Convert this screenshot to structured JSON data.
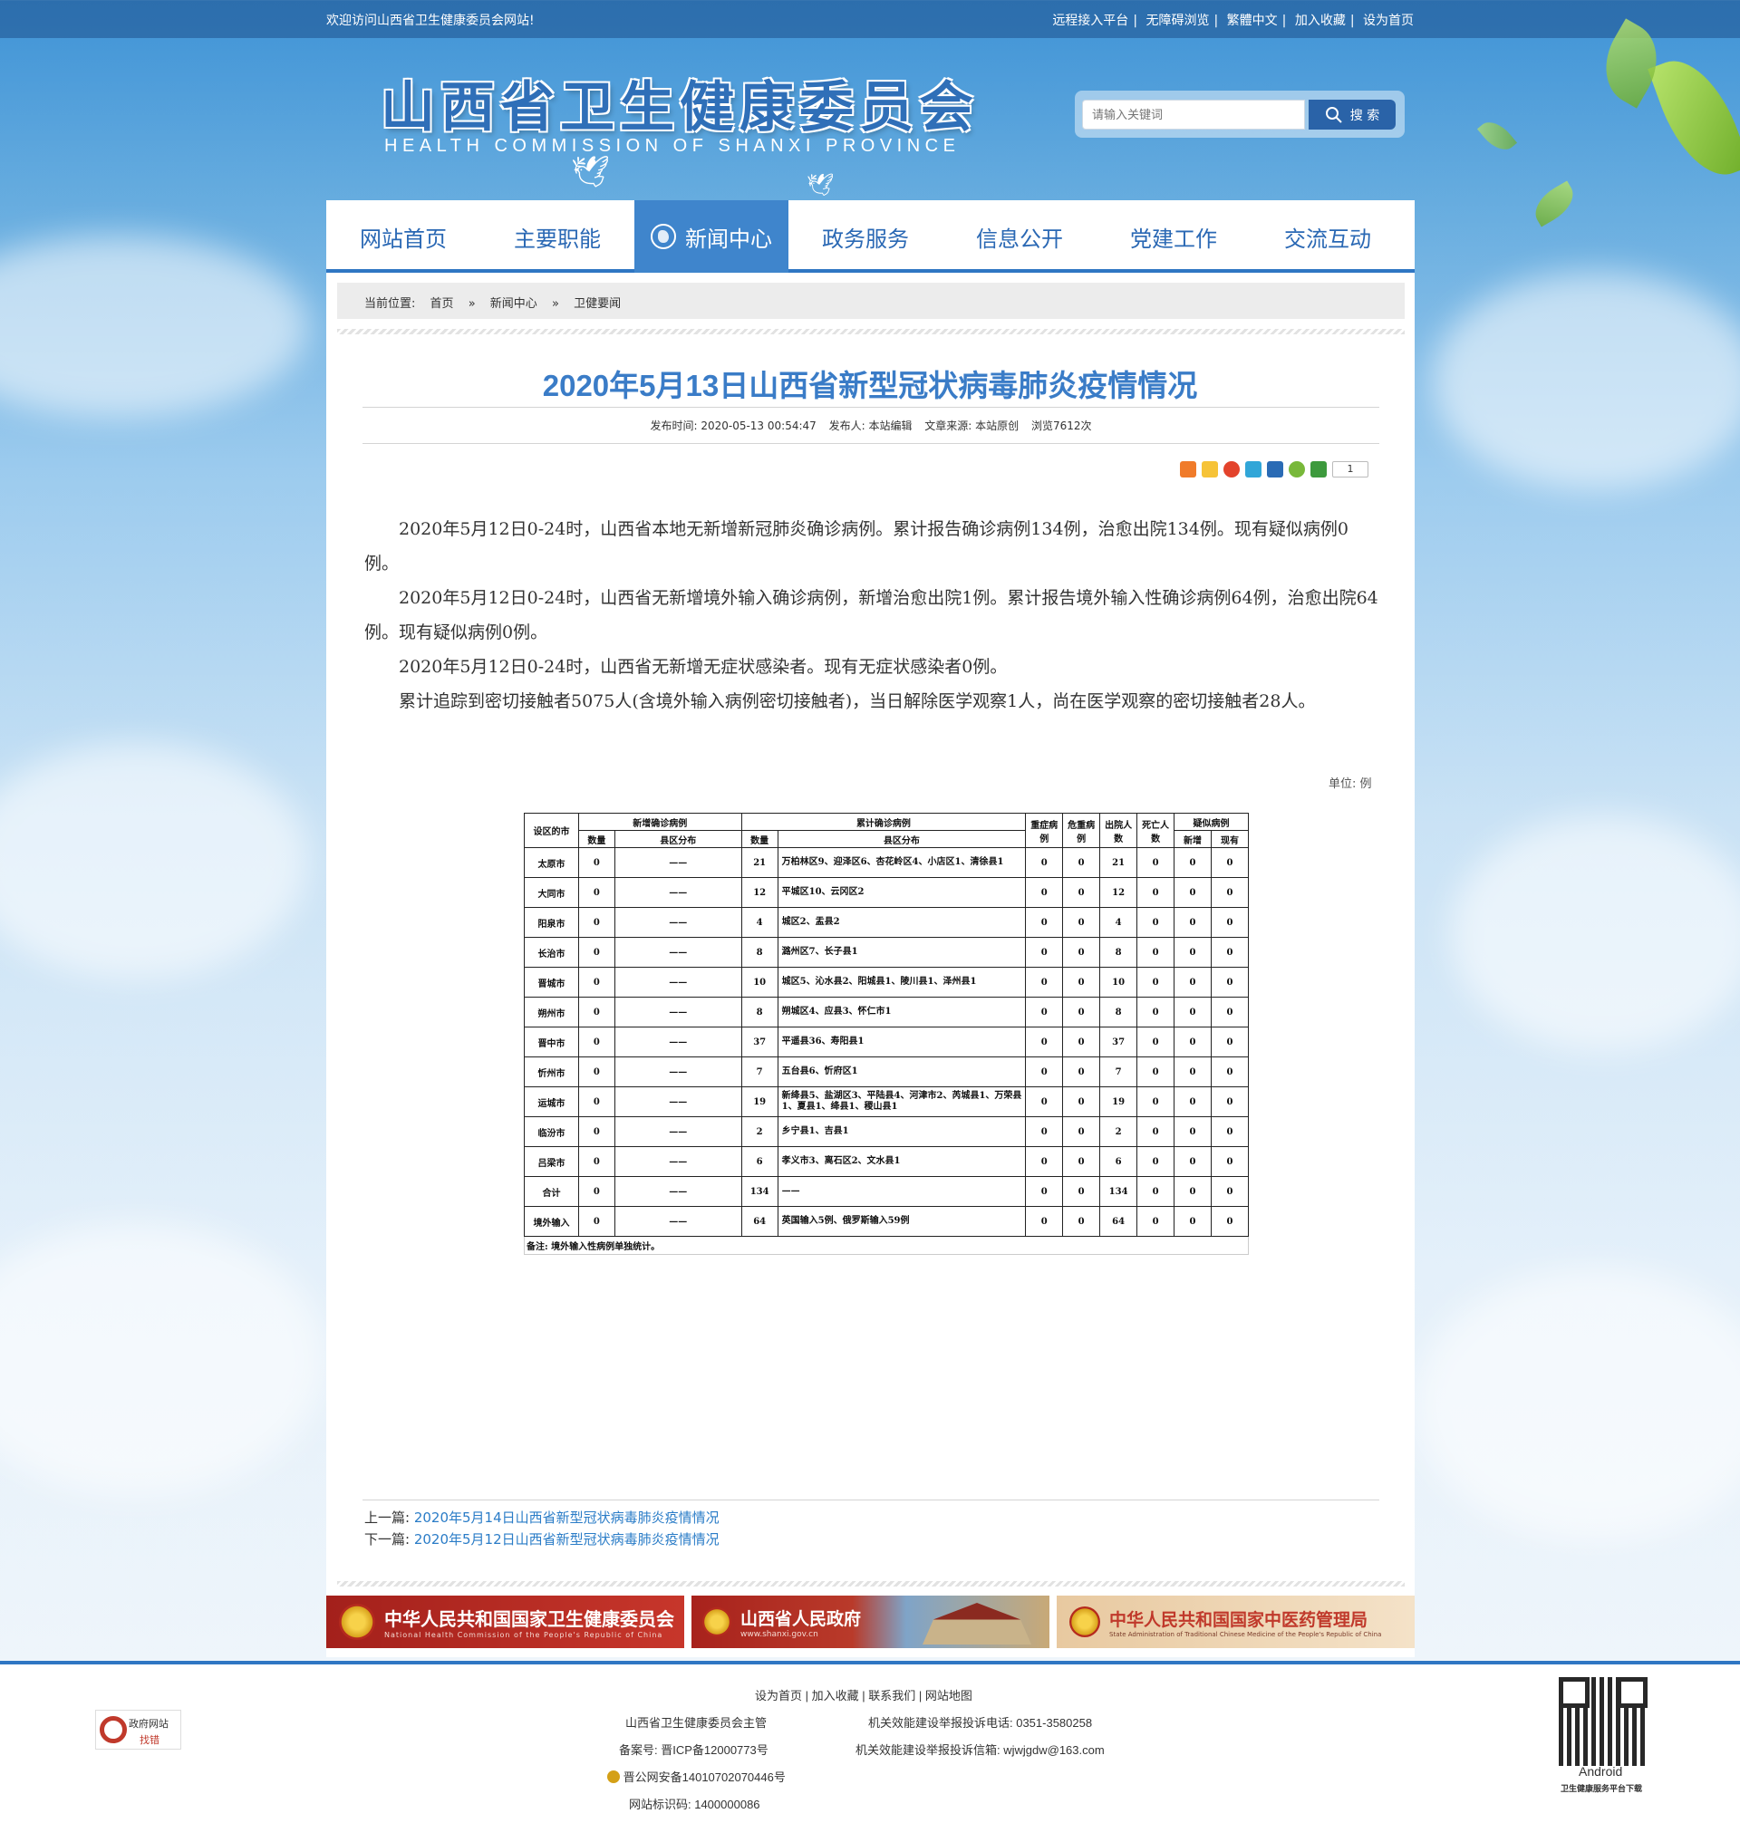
{
  "topbar": {
    "welcome": "欢迎访问山西省卫生健康委员会网站!",
    "links": [
      "远程接入平台",
      "无障碍浏览",
      "繁體中文",
      "加入收藏",
      "设为首页"
    ]
  },
  "header": {
    "logo_cn": "山西省卫生健康委员会",
    "logo_en": "HEALTH COMMISSION OF SHANXI PROVINCE",
    "search_placeholder": "请输入关键词",
    "search_button": "搜 索"
  },
  "nav": [
    "网站首页",
    "主要职能",
    "新闻中心",
    "政务服务",
    "信息公开",
    "党建工作",
    "交流互动"
  ],
  "nav_active": 2,
  "breadcrumb": {
    "label": "当前位置:",
    "items": [
      "首页",
      "新闻中心",
      "卫健要闻"
    ],
    "sep": "»"
  },
  "article": {
    "title": "2020年5月13日山西省新型冠状病毒肺炎疫情情况",
    "meta": [
      "发布时间: 2020-05-13 00:54:47",
      "发布人: 本站编辑",
      "文章来源: 本站原创",
      "浏览7612次"
    ],
    "share_count": "1",
    "paragraphs": [
      "2020年5月12日0-24时，山西省本地无新增新冠肺炎确诊病例。累计报告确诊病例134例，治愈出院134例。现有疑似病例0例。",
      "2020年5月12日0-24时，山西省无新增境外输入确诊病例，新增治愈出院1例。累计报告境外输入性确诊病例64例，治愈出院64例。现有疑似病例0例。",
      "2020年5月12日0-24时，山西省无新增无症状感染者。现有无症状感染者0例。",
      "累计追踪到密切接触者5075人(含境外输入病例密切接触者)，当日解除医学观察1人，尚在医学观察的密切接触者28人。"
    ],
    "unit": "单位: 例"
  },
  "chart_data": {
    "type": "table",
    "headers": {
      "city": "设区的市",
      "new_confirmed": "新增确诊病例",
      "cum_confirmed": "累计确诊病例",
      "count": "数量",
      "district": "县区分布",
      "severe": "重症病例",
      "critical": "危重病例",
      "discharged": "出院人数",
      "deaths": "死亡人数",
      "suspected": "疑似病例",
      "sus_new": "新增",
      "sus_current": "现有"
    },
    "rows": [
      [
        "太原市",
        "0",
        "——",
        "21",
        "万柏林区9、迎泽区6、杏花岭区4、小店区1、清徐县1",
        "0",
        "0",
        "21",
        "0",
        "0",
        "0"
      ],
      [
        "大同市",
        "0",
        "——",
        "12",
        "平城区10、云冈区2",
        "0",
        "0",
        "12",
        "0",
        "0",
        "0"
      ],
      [
        "阳泉市",
        "0",
        "——",
        "4",
        "城区2、盂县2",
        "0",
        "0",
        "4",
        "0",
        "0",
        "0"
      ],
      [
        "长治市",
        "0",
        "——",
        "8",
        "潞州区7、长子县1",
        "0",
        "0",
        "8",
        "0",
        "0",
        "0"
      ],
      [
        "晋城市",
        "0",
        "——",
        "10",
        "城区5、沁水县2、阳城县1、陵川县1、泽州县1",
        "0",
        "0",
        "10",
        "0",
        "0",
        "0"
      ],
      [
        "朔州市",
        "0",
        "——",
        "8",
        "朔城区4、应县3、怀仁市1",
        "0",
        "0",
        "8",
        "0",
        "0",
        "0"
      ],
      [
        "晋中市",
        "0",
        "——",
        "37",
        "平遥县36、寿阳县1",
        "0",
        "0",
        "37",
        "0",
        "0",
        "0"
      ],
      [
        "忻州市",
        "0",
        "——",
        "7",
        "五台县6、忻府区1",
        "0",
        "0",
        "7",
        "0",
        "0",
        "0"
      ],
      [
        "运城市",
        "0",
        "——",
        "19",
        "新绛县5、盐湖区3、平陆县4、河津市2、芮城县1、万荣县1、夏县1、绛县1、稷山县1",
        "0",
        "0",
        "19",
        "0",
        "0",
        "0"
      ],
      [
        "临汾市",
        "0",
        "——",
        "2",
        "乡宁县1、吉县1",
        "0",
        "0",
        "2",
        "0",
        "0",
        "0"
      ],
      [
        "吕梁市",
        "0",
        "——",
        "6",
        "孝义市3、离石区2、文水县1",
        "0",
        "0",
        "6",
        "0",
        "0",
        "0"
      ],
      [
        "合计",
        "0",
        "——",
        "134",
        "——",
        "0",
        "0",
        "134",
        "0",
        "0",
        "0"
      ],
      [
        "境外输入",
        "0",
        "——",
        "64",
        "英国输入5例、俄罗斯输入59例",
        "0",
        "0",
        "64",
        "0",
        "0",
        "0"
      ]
    ],
    "note": "备注: 境外输入性病例单独统计。"
  },
  "prevnext": {
    "prev_label": "上一篇:",
    "prev_title": "2020年5月14日山西省新型冠状病毒肺炎疫情情况",
    "next_label": "下一篇:",
    "next_title": "2020年5月12日山西省新型冠状病毒肺炎疫情情况"
  },
  "banners": [
    {
      "title": "中华人民共和国国家卫生健康委员会",
      "subtitle": "National Health Commission of the People's Republic of China",
      "color": "#b3261e"
    },
    {
      "title": "山西省人民政府",
      "subtitle": "www.shanxi.gov.cn",
      "color": "#b3261e"
    },
    {
      "title": "中华人民共和国国家中医药管理局",
      "subtitle": "State Administration of Traditional Chinese Medicine of the People's Republic of China",
      "color": "#c0392b"
    }
  ],
  "footer": {
    "links": [
      "设为首页",
      "加入收藏",
      "联系我们",
      "网站地图"
    ],
    "sponsor": "山西省卫生健康委员会主管",
    "phone": "机关效能建设举报投诉电话: 0351-3580258",
    "icp": "备案号: 晋ICP备12000773号",
    "email": "机关效能建设举报投诉信箱: wjwjgdw@163.com",
    "police": "晋公网安备14010702070446号",
    "site_id": "网站标识码: 1400000086",
    "badge_line1": "政府网站",
    "badge_line2": "找错",
    "qr_caption1": "Android",
    "qr_caption2": "卫生健康服务平台下载"
  }
}
